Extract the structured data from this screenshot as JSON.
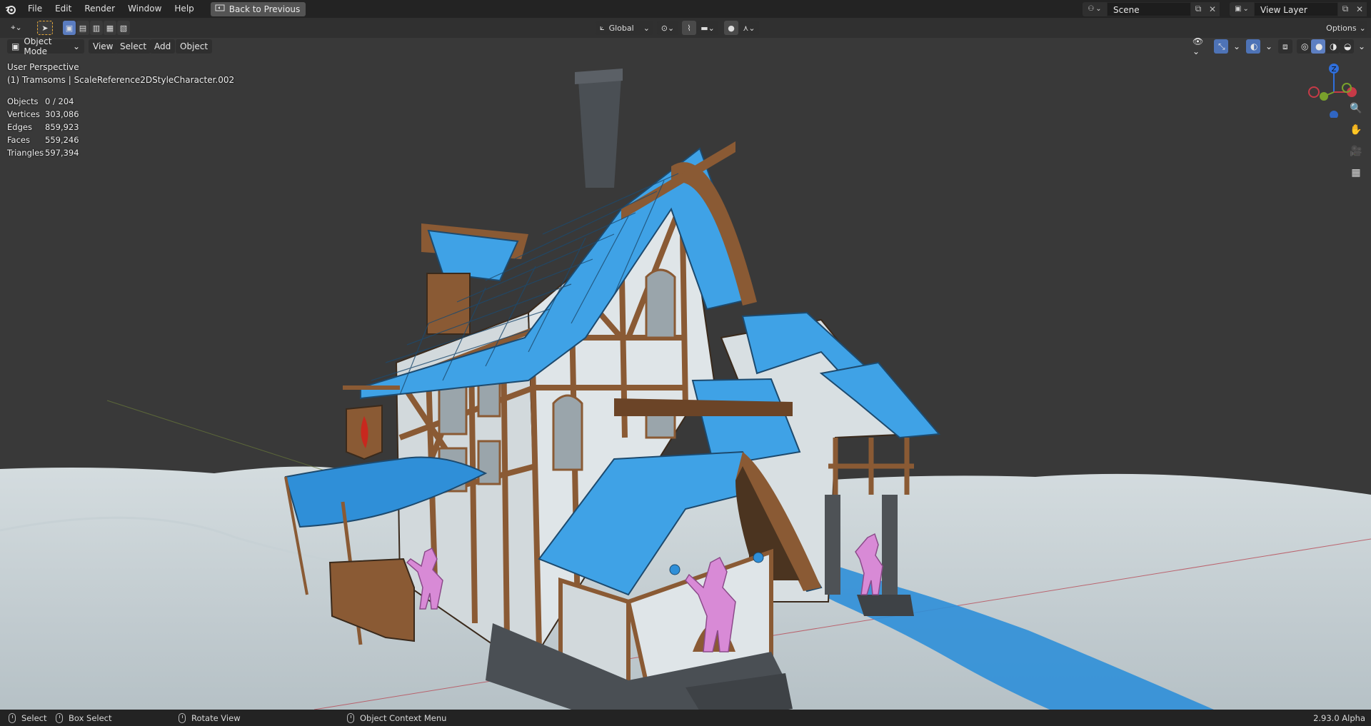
{
  "menu": {
    "items": [
      "File",
      "Edit",
      "Render",
      "Window",
      "Help"
    ],
    "back_button": "Back to Previous"
  },
  "scene": {
    "name": "Scene"
  },
  "view_layer": {
    "name": "View Layer"
  },
  "toolheader": {
    "orientation": "Global",
    "options": "Options"
  },
  "viewport_header": {
    "mode": "Object Mode",
    "menus": [
      "View",
      "Select",
      "Add",
      "Object"
    ]
  },
  "viewport": {
    "perspective": "User Perspective",
    "active_object": "(1) Tramsoms | ScaleReference2DStyleCharacter.002",
    "stats": [
      {
        "label": "Objects",
        "value": "0 / 204"
      },
      {
        "label": "Vertices",
        "value": "303,086"
      },
      {
        "label": "Edges",
        "value": "859,923"
      },
      {
        "label": "Faces",
        "value": "559,246"
      },
      {
        "label": "Triangles",
        "value": "597,394"
      }
    ],
    "gizmo": {
      "z": "Z"
    },
    "colors": {
      "roof": "#3fa2e6",
      "timber": "#8a5a34",
      "wall": "#d6dde0",
      "ground": "#c4ced3",
      "figure": "#d88ad6",
      "water": "#2f8fd8"
    }
  },
  "statusbar": {
    "select": "Select",
    "box_select": "Box Select",
    "rotate_view": "Rotate View",
    "context_menu": "Object Context Menu",
    "version": "2.93.0 Alpha"
  }
}
